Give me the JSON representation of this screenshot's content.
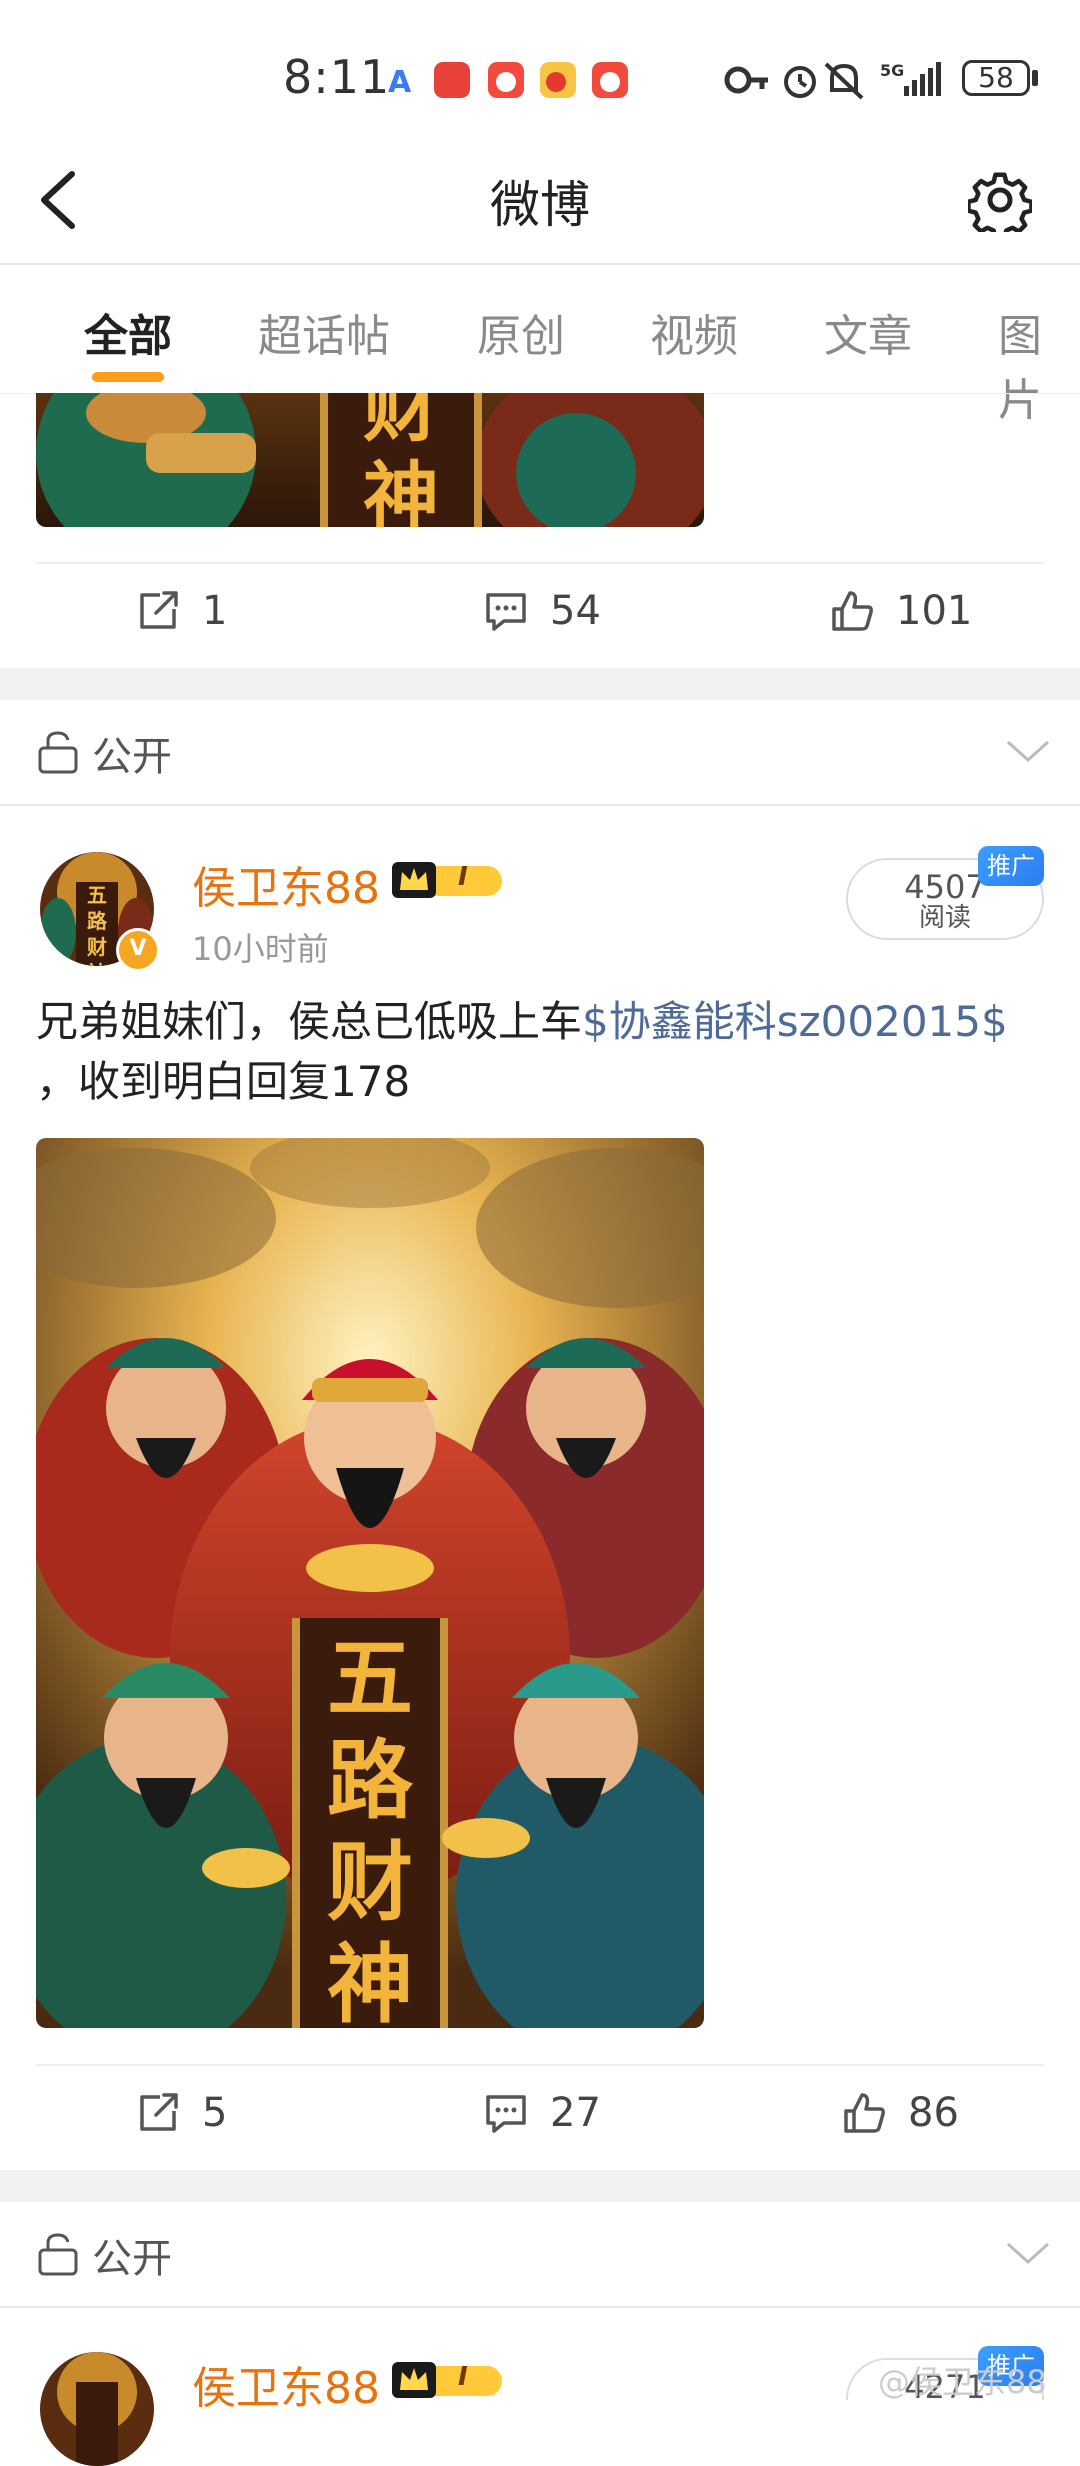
{
  "status_bar": {
    "time": "8:11",
    "battery": "58",
    "network": "5G"
  },
  "header": {
    "title": "微博",
    "back_icon": "chevron-left-icon",
    "settings_icon": "gear-icon"
  },
  "tabs": [
    {
      "label": "全部",
      "active": true
    },
    {
      "label": "超话帖",
      "active": false
    },
    {
      "label": "原创",
      "active": false
    },
    {
      "label": "视频",
      "active": false
    },
    {
      "label": "文章",
      "active": false
    },
    {
      "label": "图片",
      "active": false
    }
  ],
  "previous_post": {
    "image_text": "财神",
    "actions": {
      "repost": "1",
      "comment": "54",
      "like": "101"
    }
  },
  "post": {
    "visibility": "公开",
    "author": "侯卫东88",
    "time_ago": "10小时前",
    "reads": "4507",
    "reads_label": "阅读",
    "promo_tag": "推广",
    "text_before": "兄弟姐妹们，侯总已低吸上车",
    "text_link": "$协鑫能科sz002015$",
    "text_after": " ，收到明白回复178",
    "image_text": "五路财神",
    "avatar_text": "五路财神",
    "badge_level": "I",
    "actions": {
      "repost": "5",
      "comment": "27",
      "like": "86"
    }
  },
  "next_post": {
    "visibility": "公开",
    "author": "侯卫东88",
    "reads": "4271",
    "promo_tag": "推广",
    "badge_level": "I"
  },
  "watermark": "@侯卫东88",
  "colors": {
    "accent": "#ff9d1a",
    "author": "#e8720c",
    "link": "#4d6b96",
    "promo": "#2b7cf0"
  }
}
